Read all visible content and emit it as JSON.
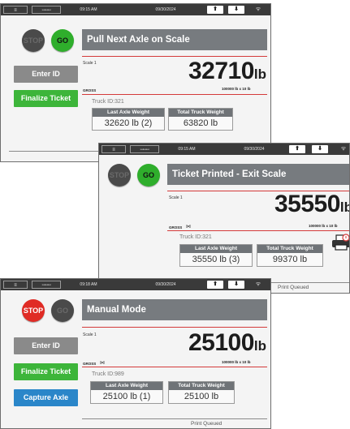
{
  "screens": {
    "s1": {
      "status": {
        "menu": "≡",
        "logo": "ꟷꟷꟷ",
        "time": "09:15 AM",
        "date": "09/30/2024",
        "up": "⬆",
        "down": "⬇",
        "wifi": "ᯤ"
      },
      "stop_label": "STOP",
      "go_label": "GO",
      "title": "Pull Next Axle on Scale",
      "scale_label": "Scale 1",
      "weight": "32710",
      "unit": "lb",
      "gross": "GROSS",
      "capacity": "100000 lb x 10 lb",
      "buttons": {
        "enter_id": "Enter ID",
        "finalize": "Finalize Ticket"
      },
      "truck_id": "Truck ID:321",
      "last_axle_header": "Last Axle Weight",
      "last_axle_value": "32620 lb (2)",
      "total_header": "Total Truck Weight",
      "total_value": "63820 lb"
    },
    "s2": {
      "status": {
        "menu": "≡",
        "logo": "ꟷꟷꟷ",
        "time": "09:15 AM",
        "date": "09/30/2024",
        "up": "⬆",
        "down": "⬇",
        "wifi": "ᯤ"
      },
      "stop_label": "STOP",
      "go_label": "GO",
      "title": "Ticket Printed - Exit Scale",
      "scale_label": "Scale 1",
      "weight": "35550",
      "unit": "lb",
      "gross": "GROSS",
      "motion": "⋈",
      "capacity": "100000 lb x 10 lb",
      "truck_id": "Truck ID:321",
      "last_axle_header": "Last Axle Weight",
      "last_axle_value": "35550 lb (3)",
      "total_header": "Total Truck Weight",
      "total_value": "99370 lb",
      "print_queued": "Print Queued"
    },
    "s3": {
      "status": {
        "menu": "≡",
        "logo": "ꟷꟷꟷ",
        "time": "09:18 AM",
        "date": "09/30/2024",
        "up": "⬆",
        "down": "⬇",
        "wifi": "ᯤ"
      },
      "stop_label": "STOP",
      "go_label": "GO",
      "title": "Manual Mode",
      "scale_label": "Scale 1",
      "weight": "25100",
      "unit": "lb",
      "gross": "GROSS",
      "motion": "⋈",
      "capacity": "100000 lb x 10 lb",
      "buttons": {
        "enter_id": "Enter ID",
        "finalize": "Finalize Ticket",
        "capture": "Capture Axle"
      },
      "truck_id": "Truck ID:989",
      "last_axle_header": "Last Axle Weight",
      "last_axle_value": "25100 lb (1)",
      "total_header": "Total Truck Weight",
      "total_value": "25100 lb",
      "print_queued": "Print Queued"
    }
  },
  "colors": {
    "stop_active": "#e02b25",
    "go_active": "#2fae2c",
    "light_off": "#4a4a4a",
    "title_bar": "#777b7f",
    "finalize": "#3db53a",
    "capture": "#2a86c9",
    "enter_id": "#8a8a8a"
  }
}
